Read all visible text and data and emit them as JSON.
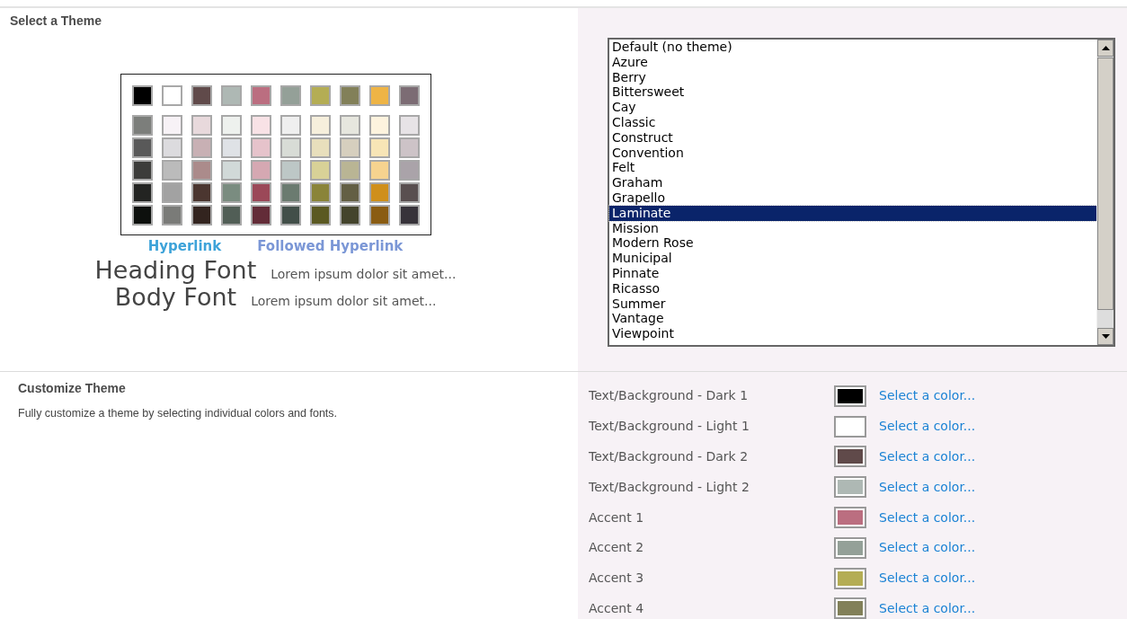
{
  "select_theme": {
    "title": "Select a Theme",
    "preview": {
      "top_colors": [
        {
          "color": "#000000"
        },
        {
          "color": "#ffffff"
        },
        {
          "color": "#604a4a"
        },
        {
          "color": "#aeb8b4"
        },
        {
          "color": "#bb6e80"
        },
        {
          "color": "#94a098"
        },
        {
          "color": "#b4ad54"
        },
        {
          "color": "#828059"
        },
        {
          "color": "#eeb445"
        },
        {
          "color": "#7c6c74"
        }
      ],
      "shade_rows": [
        [
          {
            "color": "#7c7e7b"
          },
          {
            "color": "#f7f2f6"
          },
          {
            "color": "#e8d9dc"
          },
          {
            "color": "#eef1ee"
          },
          {
            "color": "#f8e2e6"
          },
          {
            "color": "#efefef"
          },
          {
            "color": "#f6efdc"
          },
          {
            "color": "#e6e6de"
          },
          {
            "color": "#fdf3de"
          },
          {
            "color": "#e7e3e6"
          }
        ],
        [
          {
            "color": "#595959"
          },
          {
            "color": "#dcdbde"
          },
          {
            "color": "#c8b0b4"
          },
          {
            "color": "#dfe2e6"
          },
          {
            "color": "#e6c3cb"
          },
          {
            "color": "#d8dcd6"
          },
          {
            "color": "#e8dfbc"
          },
          {
            "color": "#d6cfbe"
          },
          {
            "color": "#f7e5b6"
          },
          {
            "color": "#cdc3c7"
          }
        ],
        [
          {
            "color": "#3c3c3a"
          },
          {
            "color": "#bbbbbb"
          },
          {
            "color": "#ab8b8b"
          },
          {
            "color": "#d1d9d8"
          },
          {
            "color": "#d5a8b2"
          },
          {
            "color": "#bdc7c6"
          },
          {
            "color": "#d8d197"
          },
          {
            "color": "#b9b594"
          },
          {
            "color": "#f6d38f"
          },
          {
            "color": "#aaa3a9"
          }
        ],
        [
          {
            "color": "#232422"
          },
          {
            "color": "#a2a2a2"
          },
          {
            "color": "#4b3630"
          },
          {
            "color": "#7a8c80"
          },
          {
            "color": "#9b4858"
          },
          {
            "color": "#6b7b70"
          },
          {
            "color": "#8a8439"
          },
          {
            "color": "#635f44"
          },
          {
            "color": "#cf8f1b"
          },
          {
            "color": "#594f50"
          }
        ],
        [
          {
            "color": "#0d100d"
          },
          {
            "color": "#7a7b78"
          },
          {
            "color": "#33241f"
          },
          {
            "color": "#515e56"
          },
          {
            "color": "#632c38"
          },
          {
            "color": "#424f49"
          },
          {
            "color": "#5b5922"
          },
          {
            "color": "#44442c"
          },
          {
            "color": "#8a5c12"
          },
          {
            "color": "#37333a"
          }
        ]
      ],
      "hyperlink": "Hyperlink",
      "followed_hyperlink": "Followed Hyperlink",
      "heading_font": "Heading Font",
      "heading_sample": "Lorem ipsum dolor sit amet...",
      "body_font": "Body Font",
      "body_sample": "Lorem ipsum dolor sit amet..."
    },
    "themes": [
      {
        "label": "Default (no theme)",
        "selected": false
      },
      {
        "label": "Azure",
        "selected": false
      },
      {
        "label": "Berry",
        "selected": false
      },
      {
        "label": "Bittersweet",
        "selected": false
      },
      {
        "label": "Cay",
        "selected": false
      },
      {
        "label": "Classic",
        "selected": false
      },
      {
        "label": "Construct",
        "selected": false
      },
      {
        "label": "Convention",
        "selected": false
      },
      {
        "label": "Felt",
        "selected": false
      },
      {
        "label": "Graham",
        "selected": false
      },
      {
        "label": "Grapello",
        "selected": false
      },
      {
        "label": "Laminate",
        "selected": true
      },
      {
        "label": "Mission",
        "selected": false
      },
      {
        "label": "Modern Rose",
        "selected": false
      },
      {
        "label": "Municipal",
        "selected": false
      },
      {
        "label": "Pinnate",
        "selected": false
      },
      {
        "label": "Ricasso",
        "selected": false
      },
      {
        "label": "Summer",
        "selected": false
      },
      {
        "label": "Vantage",
        "selected": false
      },
      {
        "label": "Viewpoint",
        "selected": false
      }
    ]
  },
  "customize_theme": {
    "title": "Customize Theme",
    "description": "Fully customize a theme by selecting individual colors and fonts.",
    "colors": [
      {
        "label": "Text/Background - Dark 1",
        "color": "#000000",
        "link": "Select a color..."
      },
      {
        "label": "Text/Background - Light 1",
        "color": "#ffffff",
        "link": "Select a color..."
      },
      {
        "label": "Text/Background - Dark 2",
        "color": "#604a4a",
        "link": "Select a color..."
      },
      {
        "label": "Text/Background - Light 2",
        "color": "#aeb8b4",
        "link": "Select a color..."
      },
      {
        "label": "Accent 1",
        "color": "#bb6e80",
        "link": "Select a color..."
      },
      {
        "label": "Accent 2",
        "color": "#94a098",
        "link": "Select a color..."
      },
      {
        "label": "Accent 3",
        "color": "#b4ad54",
        "link": "Select a color..."
      },
      {
        "label": "Accent 4",
        "color": "#828059",
        "link": "Select a color..."
      }
    ]
  }
}
